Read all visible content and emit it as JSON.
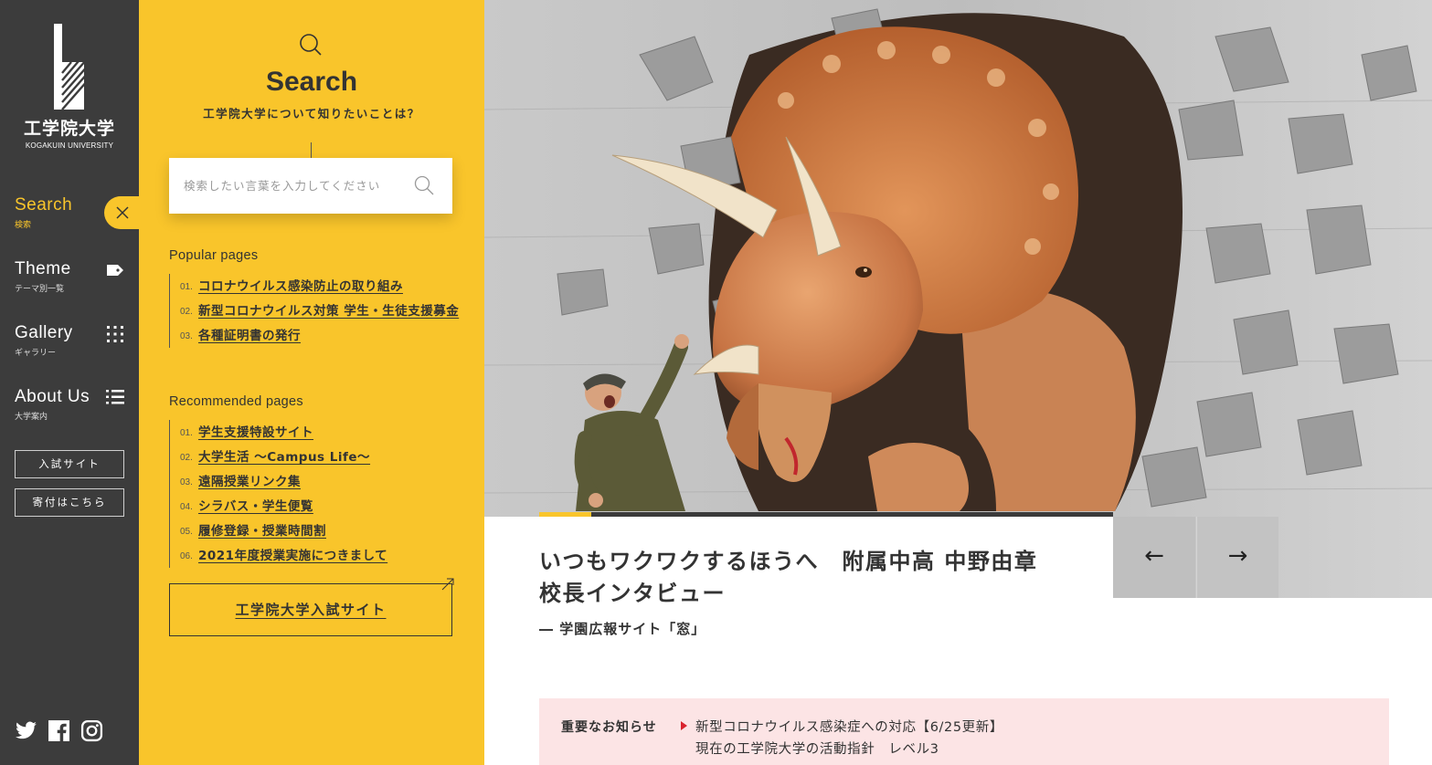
{
  "brand": {
    "name_jp": "工学院大学",
    "name_en": "KOGAKUIN UNIVERSITY",
    "accent": "#f9c52b",
    "nav_bg": "#3c3c3c"
  },
  "nav": {
    "items": [
      {
        "label": "Search",
        "sub": "検索",
        "icon": "close-icon"
      },
      {
        "label": "Theme",
        "sub": "テーマ別一覧",
        "icon": "tag-icon"
      },
      {
        "label": "Gallery",
        "sub": "ギャラリー",
        "icon": "grid-icon"
      },
      {
        "label": "About Us",
        "sub": "大学案内",
        "icon": "list-icon"
      }
    ],
    "buttons": [
      "入試サイト",
      "寄付はこちら"
    ],
    "social": [
      "twitter-icon",
      "facebook-icon",
      "instagram-icon"
    ]
  },
  "search_panel": {
    "title": "Search",
    "subtitle": "工学院大学について知りたいことは？",
    "placeholder": "検索したい言葉を入力してください",
    "popular": {
      "heading": "Popular pages",
      "items": [
        {
          "num": "01.",
          "text": "コロナウイルス感染防止の取り組み"
        },
        {
          "num": "02.",
          "text": "新型コロナウイルス対策 学生・生徒支援募金"
        },
        {
          "num": "03.",
          "text": "各種証明書の発行"
        }
      ]
    },
    "recommended": {
      "heading": "Recommended pages",
      "items": [
        {
          "num": "01.",
          "text": "学生支援特設サイト"
        },
        {
          "num": "02.",
          "text": "大学生活 〜Campus Life〜"
        },
        {
          "num": "03.",
          "text": "遠隔授業リンク集"
        },
        {
          "num": "04.",
          "text": "シラバス・学生便覧"
        },
        {
          "num": "05.",
          "text": "履修登録・授業時間割"
        },
        {
          "num": "06.",
          "text": "2021年度授業実施につきまして"
        }
      ]
    },
    "admissions_button": "工学院大学入試サイト"
  },
  "hero": {
    "headline": "いつもワクワクするほうへ　附属中高 中野由章校長インタビュー",
    "source": "―  学園広報サイト「窓」",
    "progress": 0.09,
    "prev": "←",
    "next": "→"
  },
  "notice": {
    "label": "重要なお知らせ",
    "items": [
      "新型コロナウイルス感染症への対応【6/25更新】",
      "現在の工学院大学の活動指針　レベル3"
    ]
  }
}
